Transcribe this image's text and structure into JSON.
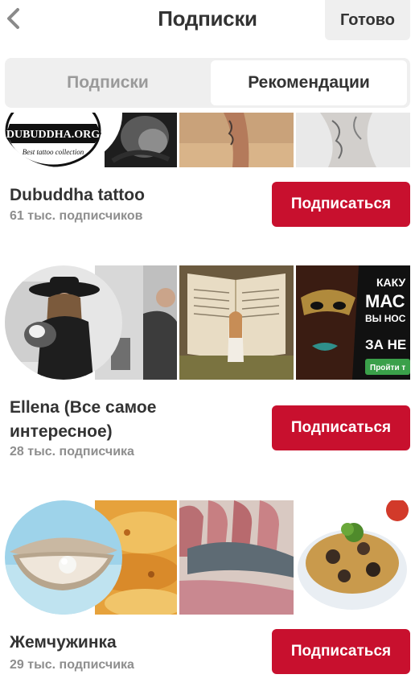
{
  "header": {
    "title": "Подписки",
    "done_label": "Готово",
    "back_icon": "chevron-left-icon"
  },
  "tabs": [
    {
      "label": "Подписки",
      "active": false
    },
    {
      "label": "Рекомендации",
      "active": true
    }
  ],
  "boards": [
    {
      "name": "Dubuddha tattoo",
      "followers": "61 тыс. подписчиков",
      "follow_label": "Подписаться",
      "logo_text": "DUBUDDHA.ORG",
      "logo_subtext": "Best tattoo collection"
    },
    {
      "name": "Ellena (Все самое интересное)",
      "followers": "28 тыс. подписчика",
      "follow_label": "Подписаться",
      "ad_lines": [
        "КАКУ",
        "МАС",
        "ВЫ НОС",
        "ЗА НЕ"
      ],
      "ad_button": "Пройти т"
    },
    {
      "name": "Жемчужинка",
      "followers": "29 тыс. подписчика",
      "follow_label": "Подписаться"
    }
  ],
  "colors": {
    "accent": "#c8102e",
    "segment_bg": "#efefef",
    "muted_text": "#8e8e8e"
  }
}
